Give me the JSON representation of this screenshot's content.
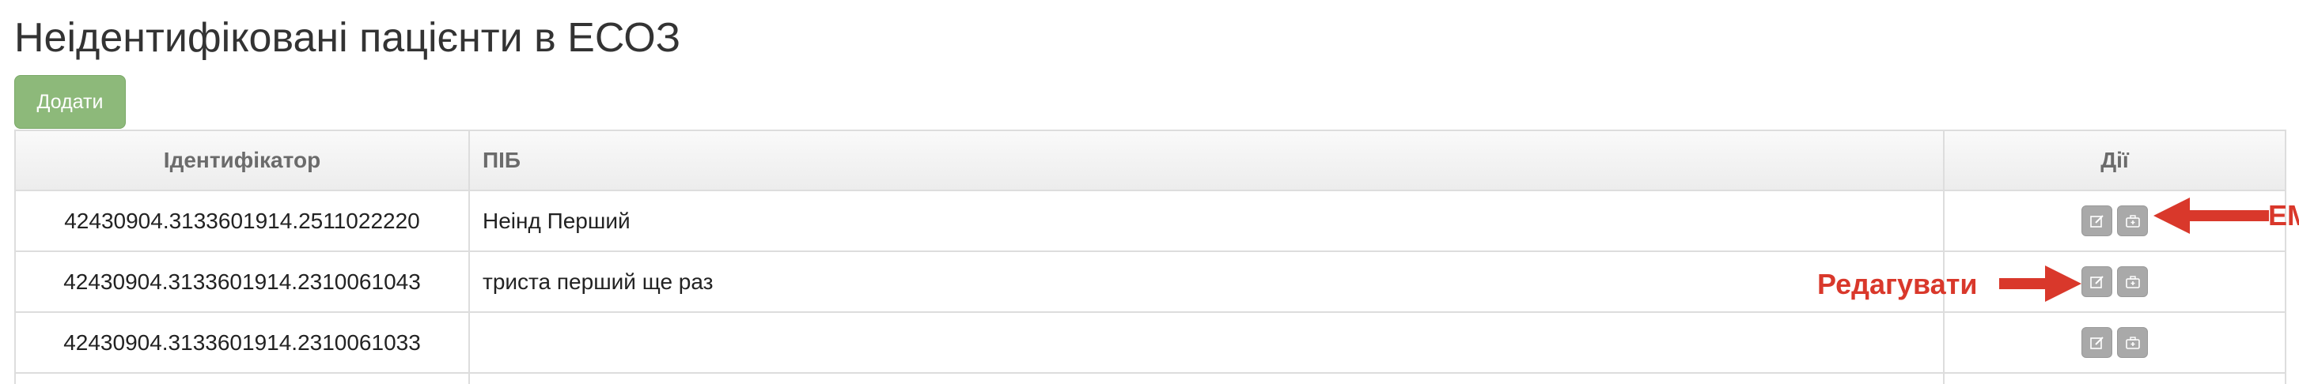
{
  "page": {
    "title": "Неідентифіковані пацієнти в ЕСОЗ"
  },
  "toolbar": {
    "add_label": "Додати",
    "add_color": "#8db97a"
  },
  "table": {
    "columns": [
      "Ідентифікатор",
      "ПІБ",
      "Дії"
    ],
    "rows": [
      {
        "id": "42430904.3133601914.2511022220",
        "name": "Неінд Перший"
      },
      {
        "id": "42430904.3133601914.2310061043",
        "name": "триста перший ще раз"
      },
      {
        "id": "42430904.3133601914.2310061033",
        "name": ""
      }
    ],
    "row_actions": [
      {
        "icon": "edit-icon"
      },
      {
        "icon": "medical-kit-icon"
      }
    ]
  },
  "annotations": {
    "emz_label": "ЕМЗ",
    "edit_label": "Редагувати",
    "color": "#d9382b"
  }
}
